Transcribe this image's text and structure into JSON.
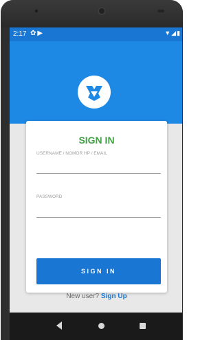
{
  "status_bar": {
    "time": "2:17",
    "left_icons": [
      "gear-icon",
      "play-icon"
    ],
    "right_icons": [
      "wifi-icon",
      "signal-icon",
      "battery-icon"
    ]
  },
  "colors": {
    "header_blue": "#1e88e5",
    "status_blue": "#1976d2",
    "title_green": "#43a047",
    "button_blue": "#1976d2"
  },
  "logo": {
    "icon": "app-logo-icon"
  },
  "login": {
    "title": "SIGN IN",
    "username_label": "USERNAME / NOMOR HP / EMAIL",
    "username_value": "",
    "password_label": "PASSWORD",
    "password_value": "",
    "sign_in_button": "SIGN IN",
    "new_user_text": "New user?",
    "sign_up_link": "Sign Up"
  },
  "nav_bar": {
    "icons": [
      "back-icon",
      "home-icon",
      "recents-icon"
    ]
  }
}
